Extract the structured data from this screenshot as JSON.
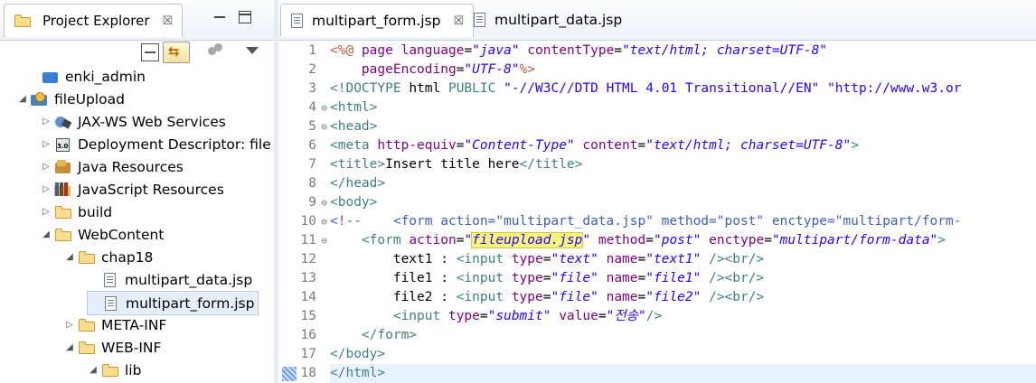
{
  "project_explorer": {
    "title": "Project Explorer",
    "close_glyph": "☒"
  },
  "toolbar": {
    "collapse_all": "collapse-all-icon",
    "link_with_editor": "⇆",
    "focus": "focus-icon",
    "view_menu": "view-menu-icon"
  },
  "tree": [
    {
      "label": "enki_admin",
      "icon": "project",
      "arrow": ""
    },
    {
      "label": "fileUpload",
      "icon": "webproj",
      "arrow": "◢"
    },
    {
      "label": "JAX-WS Web Services",
      "icon": "jaxws",
      "arrow": "▷"
    },
    {
      "label": "Deployment Descriptor: file",
      "icon": "dd",
      "arrow": "▷"
    },
    {
      "label": "Java Resources",
      "icon": "jres",
      "arrow": "▷"
    },
    {
      "label": "JavaScript Resources",
      "icon": "jsres",
      "arrow": "▷"
    },
    {
      "label": "build",
      "icon": "folder",
      "arrow": "▷"
    },
    {
      "label": "WebContent",
      "icon": "folder",
      "arrow": "◢"
    },
    {
      "label": "chap18",
      "icon": "folder",
      "arrow": "◢"
    },
    {
      "label": "multipart_data.jsp",
      "icon": "file",
      "arrow": ""
    },
    {
      "label": "multipart_form.jsp",
      "icon": "file",
      "arrow": ""
    },
    {
      "label": "META-INF",
      "icon": "folder",
      "arrow": "▷"
    },
    {
      "label": "WEB-INF",
      "icon": "folder",
      "arrow": "◢"
    },
    {
      "label": "lib",
      "icon": "folder",
      "arrow": "◢"
    }
  ],
  "editor": {
    "tabs": [
      {
        "label": "multipart_form.jsp",
        "close": "☒"
      },
      {
        "label": "multipart_data.jsp"
      }
    ],
    "lines": [
      {
        "n": "1",
        "fold": "",
        "html": "<span class=\"jsp\">&lt;%@</span> <span class=\"a\">page</span> <span class=\"a\">language</span>=<span class=\"v\">\"java\"</span> <span class=\"a\">contentType</span>=<span class=\"v\">\"text/html; charset=UTF-8\"</span>"
      },
      {
        "n": "2",
        "fold": "",
        "html": "    <span class=\"a\">pageEncoding</span>=<span class=\"v\">\"UTF-8\"</span><span class=\"jsp\">%&gt;</span>"
      },
      {
        "n": "3",
        "fold": "",
        "html": "<span class=\"k\">&lt;!DOCTYPE</span> <span class=\"t\">html</span> <span class=\"k\">PUBLIC</span> <span class=\"vn\">\"-//W3C//DTD HTML 4.01 Transitional//EN\"</span> <span class=\"vn\">\"http://www.w3.or</span>"
      },
      {
        "n": "4",
        "fold": "⊖",
        "html": "<span class=\"k\">&lt;</span><span class=\"k\">html</span><span class=\"k\">&gt;</span>"
      },
      {
        "n": "5",
        "fold": "⊖",
        "html": "<span class=\"k\">&lt;head&gt;</span>"
      },
      {
        "n": "6",
        "fold": "",
        "html": "<span class=\"k\">&lt;meta</span> <span class=\"a\">http-equiv</span>=<span class=\"v\">\"Content-Type\"</span> <span class=\"a\">content</span>=<span class=\"v\">\"text/html; charset=UTF-8\"</span><span class=\"k\">&gt;</span>"
      },
      {
        "n": "7",
        "fold": "",
        "html": "<span class=\"k\">&lt;title&gt;</span>Insert title here<span class=\"k\">&lt;/title&gt;</span>"
      },
      {
        "n": "8",
        "fold": "",
        "html": "<span class=\"k\">&lt;/head&gt;</span>"
      },
      {
        "n": "9",
        "fold": "⊖",
        "html": "<span class=\"k\">&lt;body&gt;</span>"
      },
      {
        "n": "10",
        "fold": "⊖",
        "html": "<span class=\"c\">&lt;!--    &lt;form action=\"multipart_data.jsp\" method=\"post\" enctype=\"multipart/form-</span>"
      },
      {
        "n": "11",
        "fold": "⊖",
        "html": "    <span class=\"k\">&lt;form</span> <span class=\"a\">action</span>=<span class=\"v\">\"<span class=\"hl\">fileupload.jsp</span>\"</span> <span class=\"a\">method</span>=<span class=\"v\">\"post\"</span> <span class=\"a\">enctype</span>=<span class=\"v\">\"multipart/form-data\"</span><span class=\"k\">&gt;</span>"
      },
      {
        "n": "12",
        "fold": "",
        "html": "        text1 : <span class=\"k\">&lt;input</span> <span class=\"a\">type</span>=<span class=\"v\">\"text\"</span> <span class=\"a\">name</span>=<span class=\"v\">\"text1\"</span> <span class=\"k\">/&gt;&lt;br/&gt;</span>"
      },
      {
        "n": "13",
        "fold": "",
        "html": "        file1 : <span class=\"k\">&lt;input</span> <span class=\"a\">type</span>=<span class=\"v\">\"file\"</span> <span class=\"a\">name</span>=<span class=\"v\">\"file1\"</span> <span class=\"k\">/&gt;&lt;br/&gt;</span>"
      },
      {
        "n": "14",
        "fold": "",
        "html": "        file2 : <span class=\"k\">&lt;input</span> <span class=\"a\">type</span>=<span class=\"v\">\"file\"</span> <span class=\"a\">name</span>=<span class=\"v\">\"file2\"</span> <span class=\"k\">/&gt;&lt;br/&gt;</span>"
      },
      {
        "n": "15",
        "fold": "",
        "html": "        <span class=\"k\">&lt;input</span> <span class=\"a\">type</span>=<span class=\"v\">\"submit\"</span> <span class=\"a\">value</span>=<span class=\"v\">\"전송\"</span><span class=\"k\">/&gt;</span>"
      },
      {
        "n": "16",
        "fold": "",
        "html": "    <span class=\"k\">&lt;/form&gt;</span>"
      },
      {
        "n": "17",
        "fold": "",
        "html": "<span class=\"k\">&lt;/body&gt;</span>"
      },
      {
        "n": "18",
        "fold": "",
        "html": "<span class=\"k\">&lt;/html&gt;</span>",
        "current": true
      }
    ]
  }
}
